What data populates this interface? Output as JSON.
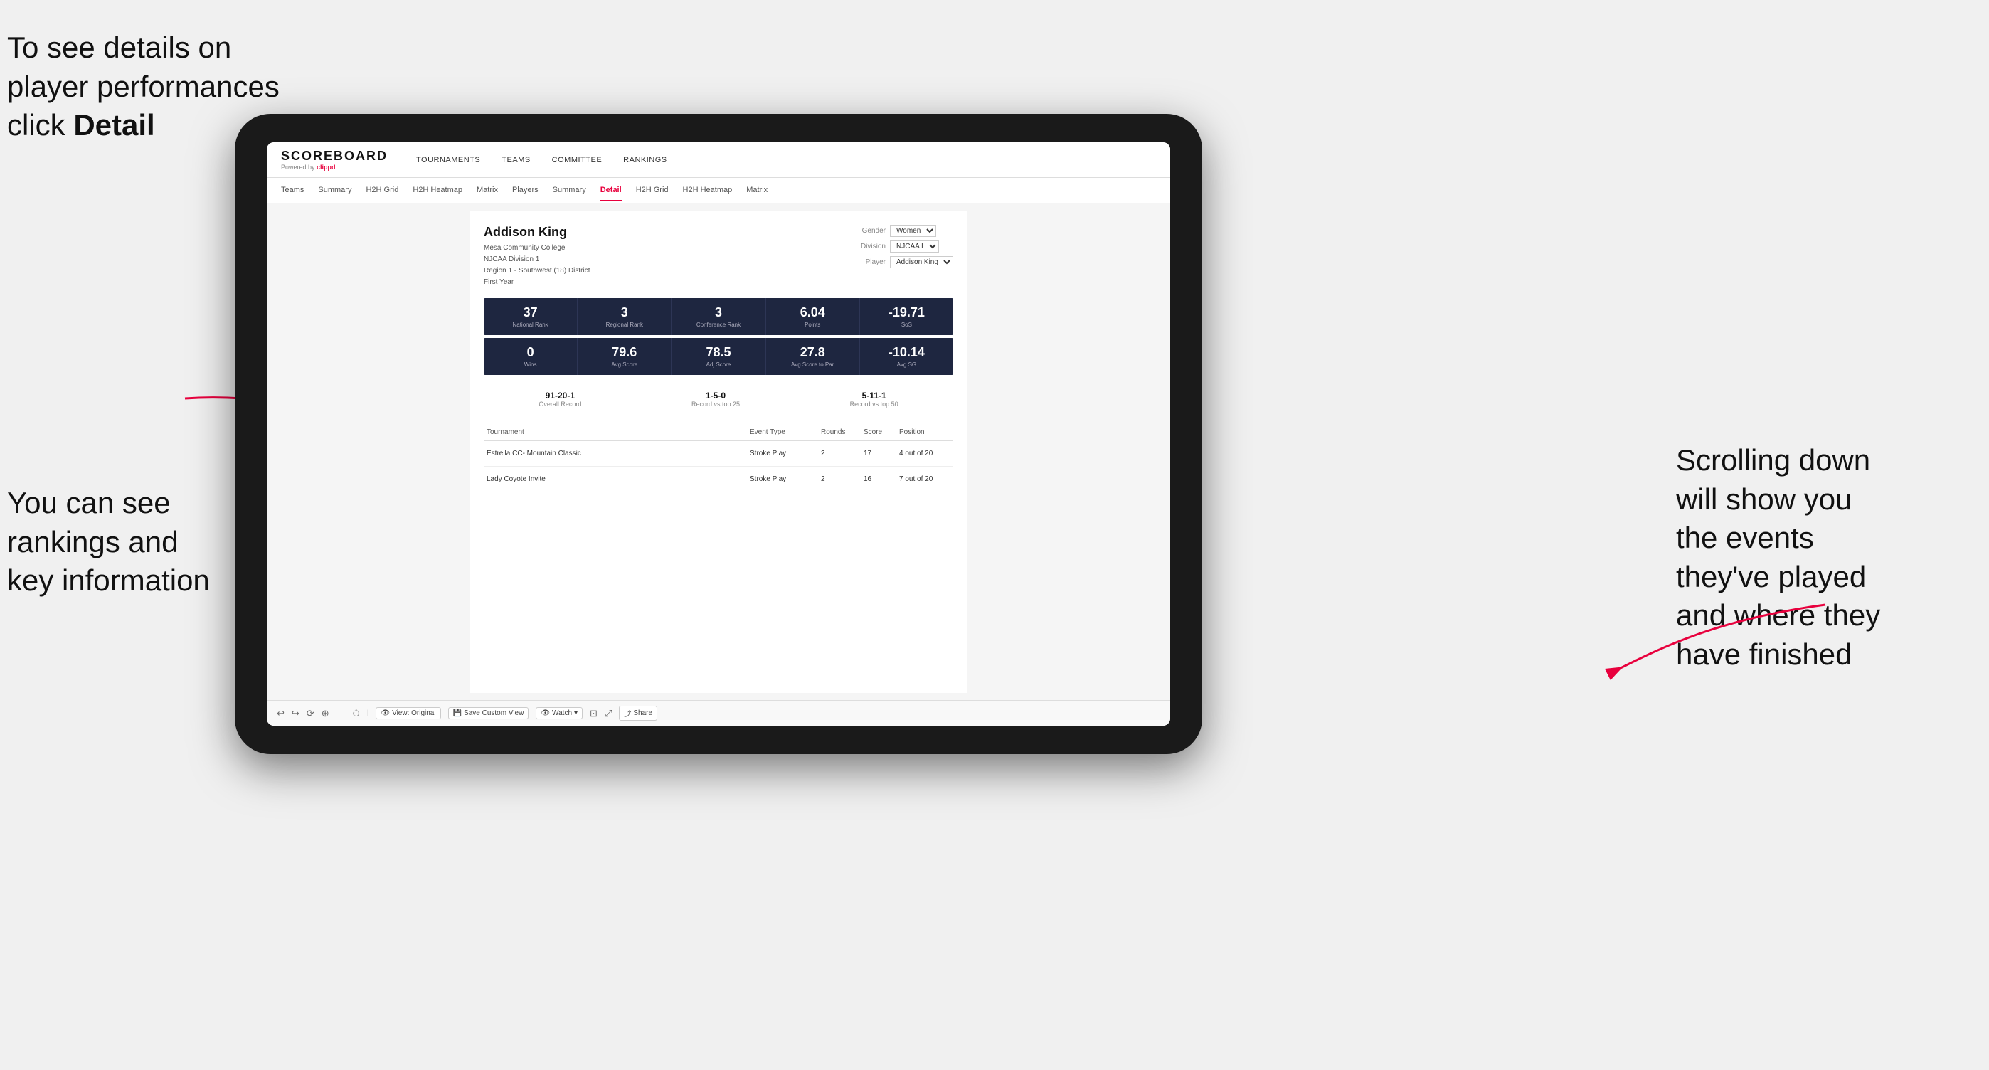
{
  "annotations": {
    "top_left": "To see details on player performances click Detail",
    "bottom_left_line1": "You can see",
    "bottom_left_line2": "rankings and",
    "bottom_left_line3": "key information",
    "right_line1": "Scrolling down",
    "right_line2": "will show you",
    "right_line3": "the events",
    "right_line4": "they've played",
    "right_line5": "and where they",
    "right_line6": "have finished"
  },
  "nav": {
    "logo": "SCOREBOARD",
    "powered_by": "Powered by",
    "powered_by_brand": "clippd",
    "items": [
      "TOURNAMENTS",
      "TEAMS",
      "COMMITTEE",
      "RANKINGS"
    ]
  },
  "sub_nav": {
    "items": [
      "Teams",
      "Summary",
      "H2H Grid",
      "H2H Heatmap",
      "Matrix",
      "Players",
      "Summary",
      "Detail",
      "H2H Grid",
      "H2H Heatmap",
      "Matrix"
    ]
  },
  "player": {
    "name": "Addison King",
    "school": "Mesa Community College",
    "division": "NJCAA Division 1",
    "region": "Region 1 - Southwest (18) District",
    "year": "First Year",
    "gender_label": "Gender",
    "gender_value": "Women",
    "division_label": "Division",
    "division_value": "NJCAA I",
    "player_label": "Player",
    "player_value": "Addison King"
  },
  "stats_row1": [
    {
      "value": "37",
      "label": "National Rank"
    },
    {
      "value": "3",
      "label": "Regional Rank"
    },
    {
      "value": "3",
      "label": "Conference Rank"
    },
    {
      "value": "6.04",
      "label": "Points"
    },
    {
      "value": "-19.71",
      "label": "SoS"
    }
  ],
  "stats_row2": [
    {
      "value": "0",
      "label": "Wins"
    },
    {
      "value": "79.6",
      "label": "Avg Score"
    },
    {
      "value": "78.5",
      "label": "Adj Score"
    },
    {
      "value": "27.8",
      "label": "Avg Score to Par"
    },
    {
      "value": "-10.14",
      "label": "Avg SG"
    }
  ],
  "records": [
    {
      "value": "91-20-1",
      "label": "Overall Record"
    },
    {
      "value": "1-5-0",
      "label": "Record vs top 25"
    },
    {
      "value": "5-11-1",
      "label": "Record vs top 50"
    }
  ],
  "table": {
    "headers": [
      "Tournament",
      "Event Type",
      "Rounds",
      "Score",
      "Position"
    ],
    "rows": [
      {
        "tournament": "Estrella CC- Mountain Classic",
        "event_type": "Stroke Play",
        "rounds": "2",
        "score": "17",
        "position": "4 out of 20"
      },
      {
        "tournament": "Lady Coyote Invite",
        "event_type": "Stroke Play",
        "rounds": "2",
        "score": "16",
        "position": "7 out of 20"
      }
    ]
  },
  "toolbar": {
    "items": [
      "View: Original",
      "Save Custom View",
      "Watch",
      "Share"
    ]
  }
}
